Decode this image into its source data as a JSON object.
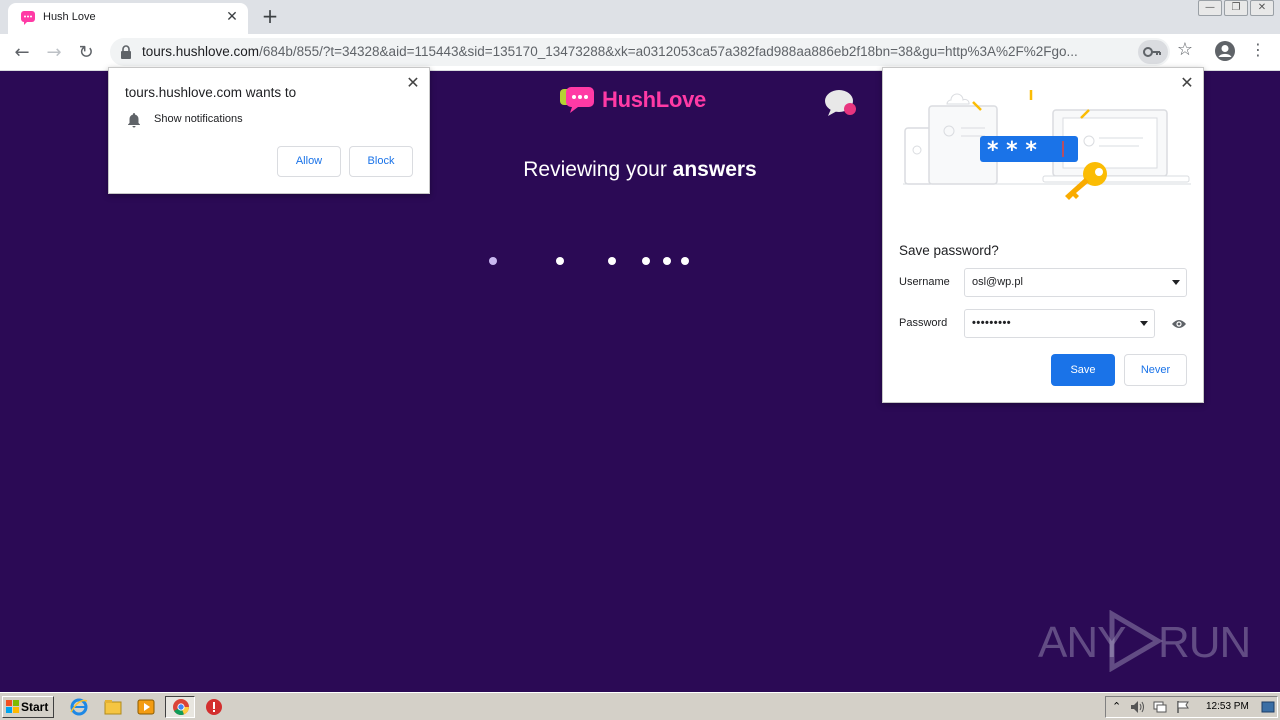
{
  "browser": {
    "tab": {
      "title": "Hush Love",
      "close_glyph": "✕"
    },
    "new_tab_glyph": "+",
    "window_controls": [
      "—",
      "❐",
      "✕"
    ],
    "url_host": "tours.hushlove.com",
    "url_rest": "/684b/855/?t=34328&aid=115443&sid=135170_13473288&xk=a0312053ca57a382fad988aa886eb2f18bn=38&gu=http%3A%2F%2Fgo...",
    "back_glyph": "←",
    "forward_glyph": "→",
    "reload_glyph": "↻",
    "star_glyph": "☆",
    "menu_glyph": "⋮"
  },
  "page": {
    "logo_text": "HushLove",
    "reviewing_prefix": "Reviewing your ",
    "reviewing_bold": "answers",
    "watermark_left": "ANY",
    "watermark_right": "RUN"
  },
  "notification_prompt": {
    "title": "tours.hushlove.com wants to",
    "permission": "Show notifications",
    "allow_label": "Allow",
    "block_label": "Block",
    "close_glyph": "✕"
  },
  "password_prompt": {
    "title": "Save password?",
    "username_label": "Username",
    "username_value": "osl@wp.pl",
    "password_label": "Password",
    "password_value": "•••••••••",
    "save_label": "Save",
    "never_label": "Never",
    "close_glyph": "✕"
  },
  "taskbar": {
    "start_label": "Start",
    "clock": "12:53 PM"
  },
  "colors": {
    "page_bg": "#2b0a55",
    "brand_pink": "#ff3aa5",
    "accent_blue": "#1a73e8"
  }
}
